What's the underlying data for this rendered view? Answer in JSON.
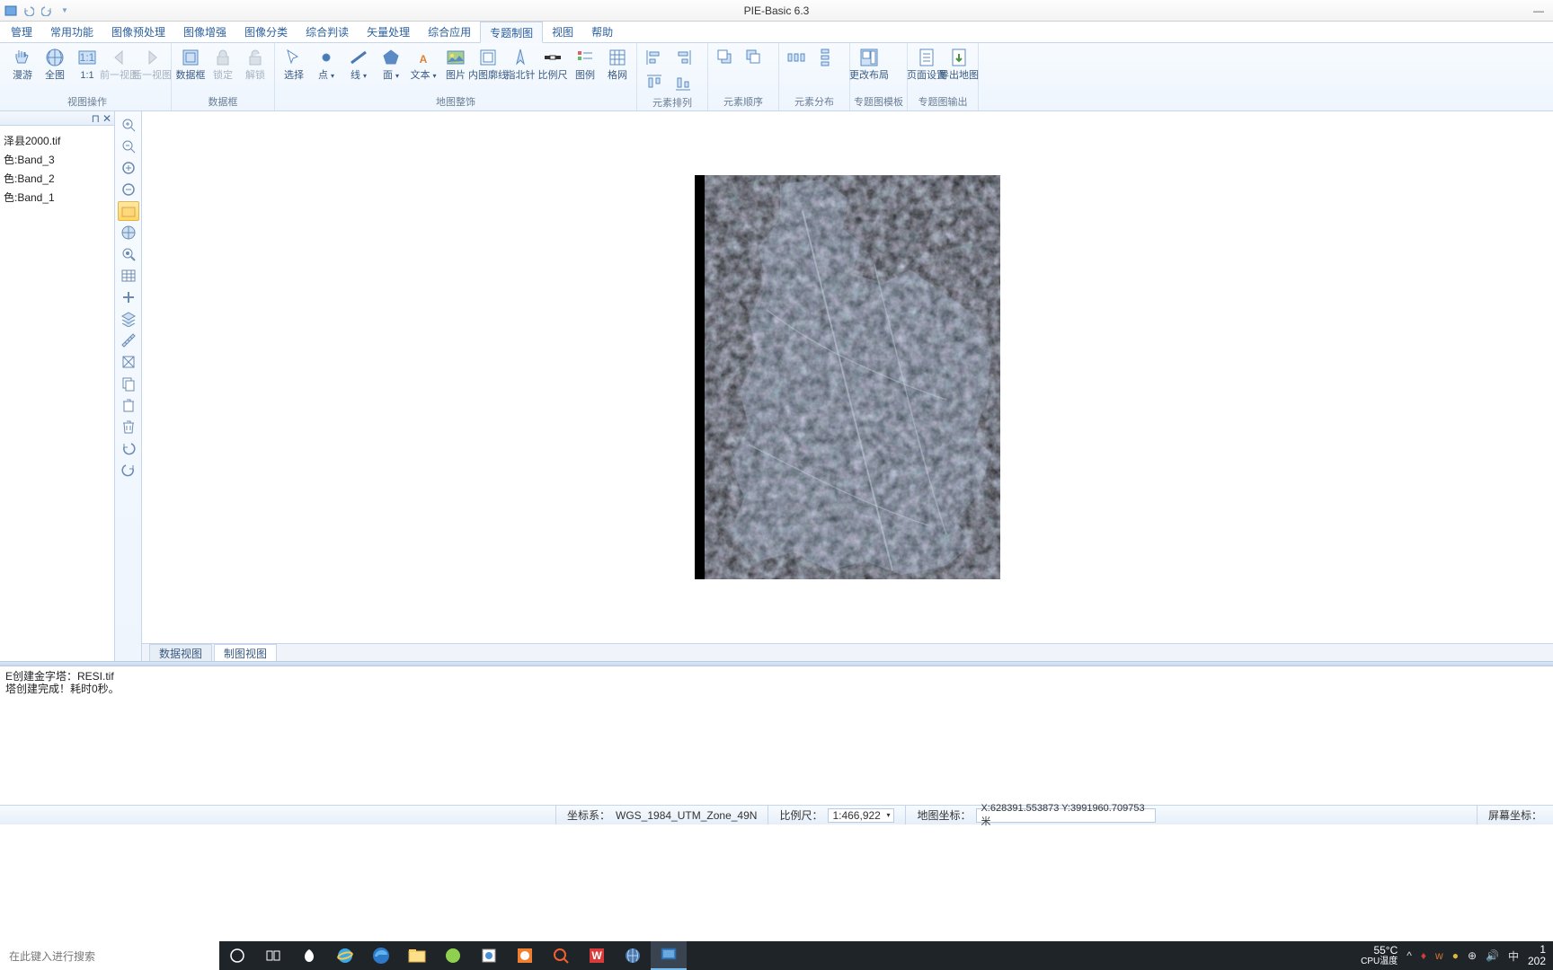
{
  "app": {
    "title": "PIE-Basic 6.3"
  },
  "menu": {
    "tabs": [
      "管理",
      "常用功能",
      "图像预处理",
      "图像增强",
      "图像分类",
      "综合判读",
      "矢量处理",
      "综合应用",
      "专题制图",
      "视图",
      "帮助"
    ],
    "active": 8
  },
  "ribbon": {
    "groups": [
      {
        "label": "视图操作",
        "buttons": [
          {
            "label": "漫游",
            "icon": "hand"
          },
          {
            "label": "全图",
            "icon": "globe"
          },
          {
            "label": "1:1",
            "icon": "oneone"
          },
          {
            "label": "前一视图",
            "icon": "prev",
            "disabled": true
          },
          {
            "label": "后一视图",
            "icon": "next",
            "disabled": true
          }
        ]
      },
      {
        "label": "数据框",
        "buttons": [
          {
            "label": "数据框",
            "icon": "dataframe"
          },
          {
            "label": "锁定",
            "icon": "lock",
            "disabled": true
          },
          {
            "label": "解锁",
            "icon": "unlock",
            "disabled": true
          }
        ]
      },
      {
        "label": "地图整饰",
        "buttons": [
          {
            "label": "选择",
            "icon": "arrow"
          },
          {
            "label": "点",
            "icon": "point",
            "drop": true
          },
          {
            "label": "线",
            "icon": "line",
            "drop": true
          },
          {
            "label": "面",
            "icon": "polygon",
            "drop": true
          },
          {
            "label": "文本",
            "icon": "text",
            "drop": true
          },
          {
            "label": "图片",
            "icon": "image"
          },
          {
            "label": "内图廓线",
            "icon": "neatline"
          },
          {
            "label": "指北针",
            "icon": "north"
          },
          {
            "label": "比例尺",
            "icon": "scalebar"
          },
          {
            "label": "图例",
            "icon": "legend"
          },
          {
            "label": "格网",
            "icon": "grid"
          }
        ]
      },
      {
        "label": "元素排列",
        "buttons": [
          {
            "label": "",
            "icon": "alignL",
            "tiny": true
          },
          {
            "label": "",
            "icon": "alignR",
            "tiny": true
          },
          {
            "label": "",
            "icon": "alignT",
            "tiny": true
          },
          {
            "label": "",
            "icon": "alignB",
            "tiny": true
          }
        ]
      },
      {
        "label": "元素顺序",
        "buttons": [
          {
            "label": "",
            "icon": "front",
            "tiny": true
          },
          {
            "label": "",
            "icon": "back",
            "tiny": true
          }
        ]
      },
      {
        "label": "元素分布",
        "buttons": [
          {
            "label": "",
            "icon": "distH",
            "tiny": true
          },
          {
            "label": "",
            "icon": "distV",
            "tiny": true
          }
        ]
      },
      {
        "label": "专题图模板",
        "buttons": [
          {
            "label": "更改布局",
            "icon": "layout"
          }
        ]
      },
      {
        "label": "专题图输出",
        "buttons": [
          {
            "label": "页面设置",
            "icon": "pagesetup"
          },
          {
            "label": "导出地图",
            "icon": "export"
          }
        ]
      }
    ]
  },
  "layers": {
    "items": [
      "泽县2000.tif",
      "色:Band_3",
      "色:Band_2",
      "色:Band_1"
    ]
  },
  "sidetools": {
    "items": [
      "zoom-in-fixed",
      "zoom-out-fixed",
      "zoom-in",
      "zoom-out",
      "pan",
      "full-extent",
      "identify",
      "table",
      "add",
      "layer",
      "measure",
      "clear",
      "copy",
      "delete",
      "trash",
      "undo",
      "redo"
    ],
    "selected": 4
  },
  "viewtabs": {
    "data": "数据视图",
    "layout": "制图视图",
    "active": 1
  },
  "log": {
    "lines": [
      "E创建金字塔：RESI.tif",
      "塔创建完成！耗时0秒。"
    ]
  },
  "status": {
    "crs_label": "坐标系：",
    "crs": "WGS_1984_UTM_Zone_49N",
    "scale_label": "比例尺：",
    "scale": "1:466,922",
    "mapcoord_label": "地图坐标：",
    "mapcoord": "X:628391.553873 Y:3991960.709753 米",
    "screen_label": "屏幕坐标："
  },
  "taskbar": {
    "search_placeholder": "在此键入进行搜索",
    "temp": "55°C",
    "temp_label": "CPU温度",
    "ime": "中",
    "time": "1",
    "date": "202"
  }
}
